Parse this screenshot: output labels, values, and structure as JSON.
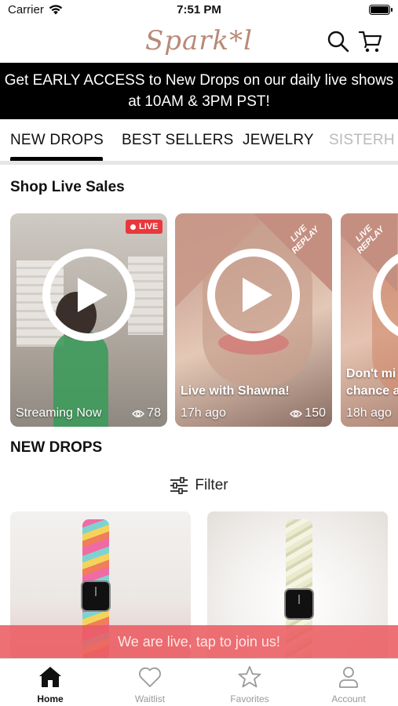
{
  "status_bar": {
    "carrier": "Carrier",
    "time": "7:51 PM"
  },
  "header": {
    "logo_text": "Spark*l",
    "brand_color": "#b98977"
  },
  "banner": {
    "text": "Get EARLY ACCESS to New Drops on our daily live shows at 10AM & 3PM PST!"
  },
  "tabs": [
    {
      "label": "NEW DROPS",
      "active": true
    },
    {
      "label": "BEST SELLERS",
      "active": false
    },
    {
      "label": "JEWELRY",
      "active": false
    },
    {
      "label": "SISTERH",
      "active": false
    }
  ],
  "live_section": {
    "title": "Shop Live Sales",
    "cards": [
      {
        "badge": "LIVE",
        "title": "",
        "subtitle": "Streaming Now",
        "views": "78"
      },
      {
        "ribbon": "LIVE REPLAY",
        "title": "Live with Shawna!",
        "subtitle": "17h ago",
        "views": "150"
      },
      {
        "ribbon": "LIVE REPLAY",
        "title": "Don't mi",
        "title_line2": "chance a",
        "subtitle": "18h ago"
      }
    ]
  },
  "new_drops": {
    "title": "NEW DROPS",
    "filter_label": "Filter"
  },
  "live_toast": {
    "text": "We are live, tap to join us!",
    "color": "#eb5c62"
  },
  "tab_bar": [
    {
      "label": "Home",
      "icon": "home-icon",
      "active": true
    },
    {
      "label": "Waitlist",
      "icon": "heart-icon",
      "active": false
    },
    {
      "label": "Favorites",
      "icon": "star-icon",
      "active": false
    },
    {
      "label": "Account",
      "icon": "person-icon",
      "active": false
    }
  ]
}
